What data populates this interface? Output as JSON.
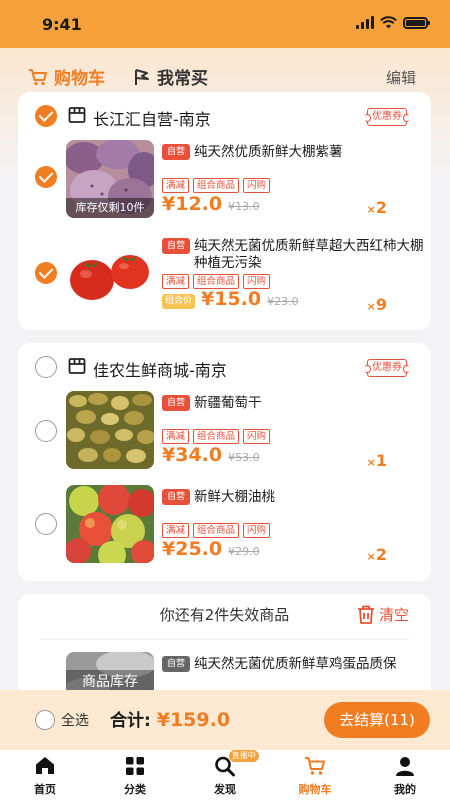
{
  "status_bar": {
    "time": "9:41"
  },
  "header": {
    "tab_cart": "购物车",
    "tab_frequent": "我常买",
    "edit": "编辑"
  },
  "stores": [
    {
      "name": "长江汇自营-南京",
      "coupon": "优惠券",
      "selected": true,
      "items": [
        {
          "badge": "自营",
          "title": "纯天然优质新鲜大棚紫薯",
          "tags": [
            "满减",
            "组合商品",
            "闪购"
          ],
          "price": "¥12.0",
          "old_price": "¥13.0",
          "qty_prefix": "×",
          "qty": "2",
          "stock_note": "库存仅剩10件",
          "selected": true
        },
        {
          "badge": "自营",
          "title": "纯天然无菌优质新鲜草超大西红柿大棚种植无污染",
          "tags": [
            "满减",
            "组合商品",
            "闪购"
          ],
          "combo_label": "组合价",
          "price": "¥15.0",
          "old_price": "¥23.0",
          "qty_prefix": "×",
          "qty": "9",
          "selected": true
        }
      ]
    },
    {
      "name": "佳农生鲜商城-南京",
      "coupon": "优惠券",
      "selected": false,
      "items": [
        {
          "badge": "自营",
          "title": "新疆葡萄干",
          "tags": [
            "满减",
            "组合商品",
            "闪购"
          ],
          "price": "¥34.0",
          "old_price": "¥53.0",
          "qty_prefix": "×",
          "qty": "1",
          "selected": false
        },
        {
          "badge": "自营",
          "title": "新鲜大棚油桃",
          "tags": [
            "满减",
            "组合商品",
            "闪购"
          ],
          "price": "¥25.0",
          "old_price": "¥29.0",
          "qty_prefix": "×",
          "qty": "2",
          "selected": false
        }
      ]
    }
  ],
  "invalid": {
    "title": "你还有2件失效商品",
    "clear": "清空",
    "item": {
      "badge": "自营",
      "title": "纯天然无菌优质新鲜草鸡蛋品质保",
      "stock_note": "商品库存"
    }
  },
  "footer": {
    "select_all": "全选",
    "total_label": "合计:",
    "total_amount": "¥159.0",
    "checkout": "去结算(11)"
  },
  "tabbar": {
    "items": [
      {
        "label": "首页",
        "icon": "home-icon"
      },
      {
        "label": "分类",
        "icon": "category-icon"
      },
      {
        "label": "发现",
        "icon": "search-icon",
        "badge": "直播中"
      },
      {
        "label": "购物车",
        "icon": "cart-icon"
      },
      {
        "label": "我的",
        "icon": "user-icon"
      }
    ]
  },
  "colors": {
    "accent": "#f07d22",
    "status_bar": "#f6a13a",
    "red": "#e8503a"
  }
}
